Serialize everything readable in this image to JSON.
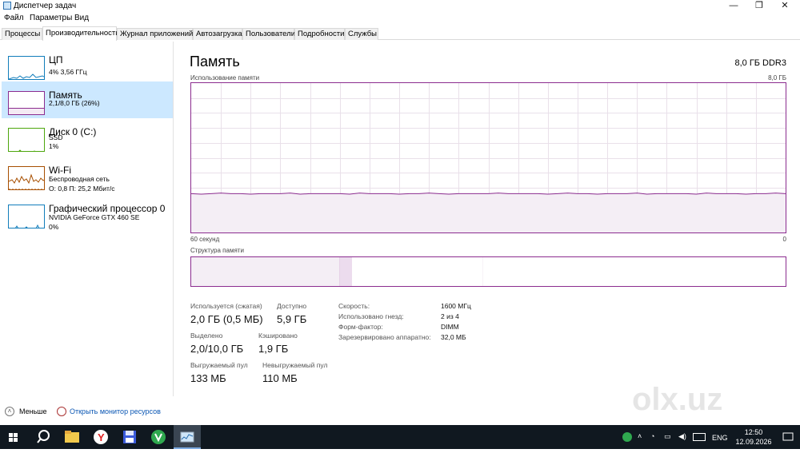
{
  "window": {
    "title": "Диспетчер задач",
    "controls": {
      "minimize": "—",
      "maximize": "❐",
      "close": "✕"
    }
  },
  "menu": [
    "Файл",
    "Параметры",
    "Вид"
  ],
  "tabs": [
    "Процессы",
    "Производительность",
    "Журнал приложений",
    "Автозагрузка",
    "Пользователи",
    "Подробности",
    "Службы"
  ],
  "active_tab_index": 1,
  "sidebar": {
    "items": [
      {
        "name": "ЦП",
        "sub1": "4% 3,56 ГГц",
        "sub2": "",
        "sub3": "",
        "icon": "cpu-graph-icon"
      },
      {
        "name": "Память",
        "sub1": "2,1/8,0 ГБ (26%)",
        "sub2": "",
        "sub3": "",
        "icon": "memory-graph-icon"
      },
      {
        "name": "Диск 0 (C:)",
        "sub1": "SSD",
        "sub2": "1%",
        "sub3": "",
        "icon": "disk-graph-icon"
      },
      {
        "name": "Wi-Fi",
        "sub1": "Беспроводная сеть",
        "sub2": "О: 0,8 П: 25,2 Мбит/с",
        "sub3": "",
        "icon": "wifi-graph-icon"
      },
      {
        "name": "Графический процессор 0",
        "sub1": "NVIDIA GeForce GTX 460 SE",
        "sub2": "0%",
        "sub3": "",
        "icon": "gpu-graph-icon"
      }
    ],
    "selected_index": 1
  },
  "main": {
    "title": "Память",
    "spec": "8,0 ГБ DDR3",
    "graph_label": "Использование памяти",
    "graph_max": "8,0 ГБ",
    "graph_time_left": "60 секунд",
    "graph_time_right": "0",
    "usage_fraction": 0.26,
    "composition_label": "Структура памяти",
    "composition": {
      "in_use": 0.25,
      "modified": 0.02,
      "standby": 0.22,
      "free": 0.51
    },
    "stats": {
      "in_use_label": "Используется (сжатая)",
      "in_use_value": "2,0 ГБ (0,5 МБ)",
      "available_label": "Доступно",
      "available_value": "5,9 ГБ",
      "committed_label": "Выделено",
      "committed_value": "2,0/10,0 ГБ",
      "cached_label": "Кэшировано",
      "cached_value": "1,9 ГБ",
      "paged_label": "Выгружаемый пул",
      "paged_value": "133 МБ",
      "nonpaged_label": "Невыгружаемый пул",
      "nonpaged_value": "110 МБ"
    },
    "props": [
      {
        "label": "Скорость:",
        "value": "1600 МГц"
      },
      {
        "label": "Использовано гнезд:",
        "value": "2 из 4"
      },
      {
        "label": "Форм-фактор:",
        "value": "DIMM"
      },
      {
        "label": "Зарезервировано аппаратно:",
        "value": "32,0 МБ"
      }
    ]
  },
  "footer": {
    "less": "Меньше",
    "resource_monitor": "Открыть монитор ресурсов"
  },
  "watermark": "olx.uz",
  "taskbar": {
    "lang": "ENG",
    "time": "12:50",
    "date": "12.09.2026"
  },
  "colors": {
    "accent_memory": "#8b2c8f",
    "accent_cpu": "#117dbb",
    "accent_disk": "#4da60c",
    "accent_wifi": "#a74f01",
    "accent_gpu": "#117dbb",
    "selected_bg": "#cce8ff",
    "taskbar_bg": "#101820"
  }
}
